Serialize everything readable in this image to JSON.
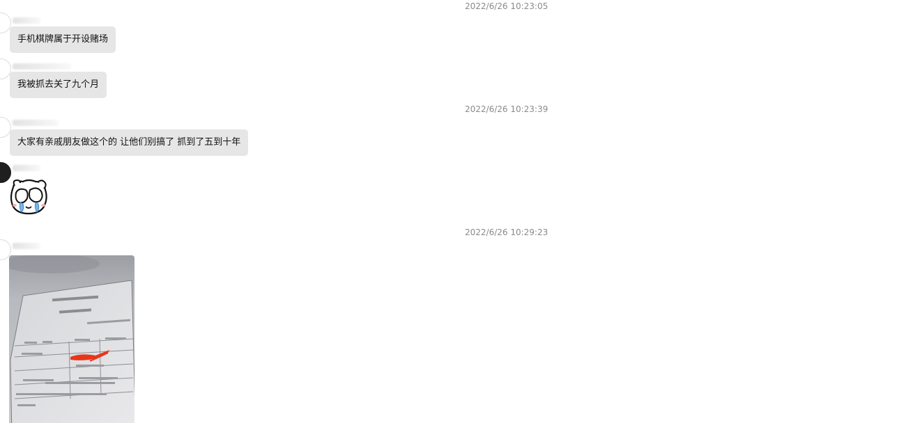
{
  "timestamps": [
    "2022/6/26 10:23:05",
    "2022/6/26 10:23:39",
    "2022/6/26 10:29:23"
  ],
  "messages": [
    {
      "text": "手机棋牌属于开设赌场"
    },
    {
      "text": "我被抓去关了九个月"
    },
    {
      "text": "大家有亲戚朋友做这个的 让他们别搞了 抓到了五到十年"
    }
  ],
  "sticker": {
    "icon": "crying-bear-sticker-icon"
  },
  "photo": {
    "icon": "certificate-photo-icon"
  },
  "colors": {
    "bubble": "#e6e6e6",
    "timestamp": "#8a8a8a",
    "background": "#ffffff",
    "redaction": "#e8361c"
  }
}
